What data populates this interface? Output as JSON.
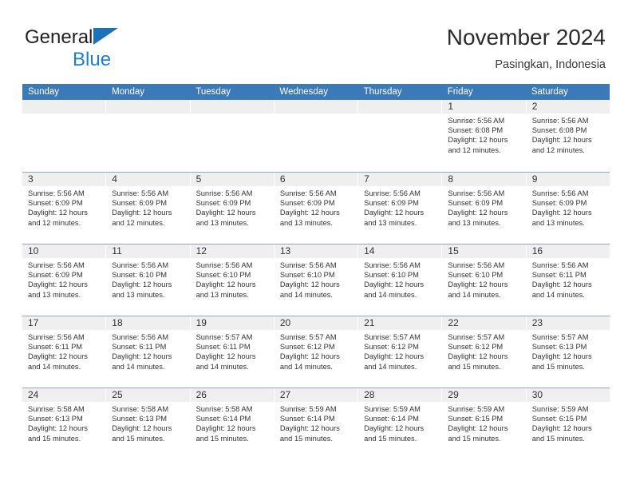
{
  "brand": {
    "name_part1": "General",
    "name_part2": "Blue",
    "flag_icon": "blue-triangle-flag-icon"
  },
  "header": {
    "title": "November 2024",
    "subtitle": "Pasingkan, Indonesia"
  },
  "colors": {
    "header_blue": "#3b79b8",
    "brand_blue": "#1a7fd4",
    "flag_blue": "#1d71b8",
    "day_band_gray": "#efefef",
    "week_separator": "#8ea9c4",
    "text": "#333333"
  },
  "weekdays": [
    "Sunday",
    "Monday",
    "Tuesday",
    "Wednesday",
    "Thursday",
    "Friday",
    "Saturday"
  ],
  "labels": {
    "sunrise_prefix": "Sunrise: ",
    "sunset_prefix": "Sunset: ",
    "daylight_prefix": "Daylight: "
  },
  "weeks": [
    [
      {
        "day": "",
        "empty": true,
        "line1": "",
        "line2": "",
        "line3": "",
        "line4": ""
      },
      {
        "day": "",
        "empty": true,
        "line1": "",
        "line2": "",
        "line3": "",
        "line4": ""
      },
      {
        "day": "",
        "empty": true,
        "line1": "",
        "line2": "",
        "line3": "",
        "line4": ""
      },
      {
        "day": "",
        "empty": true,
        "line1": "",
        "line2": "",
        "line3": "",
        "line4": ""
      },
      {
        "day": "",
        "empty": true,
        "line1": "",
        "line2": "",
        "line3": "",
        "line4": ""
      },
      {
        "day": "1",
        "empty": false,
        "line1": "Sunrise: 5:56 AM",
        "line2": "Sunset: 6:08 PM",
        "line3": "Daylight: 12 hours",
        "line4": "and 12 minutes."
      },
      {
        "day": "2",
        "empty": false,
        "line1": "Sunrise: 5:56 AM",
        "line2": "Sunset: 6:08 PM",
        "line3": "Daylight: 12 hours",
        "line4": "and 12 minutes."
      }
    ],
    [
      {
        "day": "3",
        "empty": false,
        "line1": "Sunrise: 5:56 AM",
        "line2": "Sunset: 6:09 PM",
        "line3": "Daylight: 12 hours",
        "line4": "and 12 minutes."
      },
      {
        "day": "4",
        "empty": false,
        "line1": "Sunrise: 5:56 AM",
        "line2": "Sunset: 6:09 PM",
        "line3": "Daylight: 12 hours",
        "line4": "and 12 minutes."
      },
      {
        "day": "5",
        "empty": false,
        "line1": "Sunrise: 5:56 AM",
        "line2": "Sunset: 6:09 PM",
        "line3": "Daylight: 12 hours",
        "line4": "and 13 minutes."
      },
      {
        "day": "6",
        "empty": false,
        "line1": "Sunrise: 5:56 AM",
        "line2": "Sunset: 6:09 PM",
        "line3": "Daylight: 12 hours",
        "line4": "and 13 minutes."
      },
      {
        "day": "7",
        "empty": false,
        "line1": "Sunrise: 5:56 AM",
        "line2": "Sunset: 6:09 PM",
        "line3": "Daylight: 12 hours",
        "line4": "and 13 minutes."
      },
      {
        "day": "8",
        "empty": false,
        "line1": "Sunrise: 5:56 AM",
        "line2": "Sunset: 6:09 PM",
        "line3": "Daylight: 12 hours",
        "line4": "and 13 minutes."
      },
      {
        "day": "9",
        "empty": false,
        "line1": "Sunrise: 5:56 AM",
        "line2": "Sunset: 6:09 PM",
        "line3": "Daylight: 12 hours",
        "line4": "and 13 minutes."
      }
    ],
    [
      {
        "day": "10",
        "empty": false,
        "line1": "Sunrise: 5:56 AM",
        "line2": "Sunset: 6:09 PM",
        "line3": "Daylight: 12 hours",
        "line4": "and 13 minutes."
      },
      {
        "day": "11",
        "empty": false,
        "line1": "Sunrise: 5:56 AM",
        "line2": "Sunset: 6:10 PM",
        "line3": "Daylight: 12 hours",
        "line4": "and 13 minutes."
      },
      {
        "day": "12",
        "empty": false,
        "line1": "Sunrise: 5:56 AM",
        "line2": "Sunset: 6:10 PM",
        "line3": "Daylight: 12 hours",
        "line4": "and 13 minutes."
      },
      {
        "day": "13",
        "empty": false,
        "line1": "Sunrise: 5:56 AM",
        "line2": "Sunset: 6:10 PM",
        "line3": "Daylight: 12 hours",
        "line4": "and 14 minutes."
      },
      {
        "day": "14",
        "empty": false,
        "line1": "Sunrise: 5:56 AM",
        "line2": "Sunset: 6:10 PM",
        "line3": "Daylight: 12 hours",
        "line4": "and 14 minutes."
      },
      {
        "day": "15",
        "empty": false,
        "line1": "Sunrise: 5:56 AM",
        "line2": "Sunset: 6:10 PM",
        "line3": "Daylight: 12 hours",
        "line4": "and 14 minutes."
      },
      {
        "day": "16",
        "empty": false,
        "line1": "Sunrise: 5:56 AM",
        "line2": "Sunset: 6:11 PM",
        "line3": "Daylight: 12 hours",
        "line4": "and 14 minutes."
      }
    ],
    [
      {
        "day": "17",
        "empty": false,
        "line1": "Sunrise: 5:56 AM",
        "line2": "Sunset: 6:11 PM",
        "line3": "Daylight: 12 hours",
        "line4": "and 14 minutes."
      },
      {
        "day": "18",
        "empty": false,
        "line1": "Sunrise: 5:56 AM",
        "line2": "Sunset: 6:11 PM",
        "line3": "Daylight: 12 hours",
        "line4": "and 14 minutes."
      },
      {
        "day": "19",
        "empty": false,
        "line1": "Sunrise: 5:57 AM",
        "line2": "Sunset: 6:11 PM",
        "line3": "Daylight: 12 hours",
        "line4": "and 14 minutes."
      },
      {
        "day": "20",
        "empty": false,
        "line1": "Sunrise: 5:57 AM",
        "line2": "Sunset: 6:12 PM",
        "line3": "Daylight: 12 hours",
        "line4": "and 14 minutes."
      },
      {
        "day": "21",
        "empty": false,
        "line1": "Sunrise: 5:57 AM",
        "line2": "Sunset: 6:12 PM",
        "line3": "Daylight: 12 hours",
        "line4": "and 14 minutes."
      },
      {
        "day": "22",
        "empty": false,
        "line1": "Sunrise: 5:57 AM",
        "line2": "Sunset: 6:12 PM",
        "line3": "Daylight: 12 hours",
        "line4": "and 15 minutes."
      },
      {
        "day": "23",
        "empty": false,
        "line1": "Sunrise: 5:57 AM",
        "line2": "Sunset: 6:13 PM",
        "line3": "Daylight: 12 hours",
        "line4": "and 15 minutes."
      }
    ],
    [
      {
        "day": "24",
        "empty": false,
        "line1": "Sunrise: 5:58 AM",
        "line2": "Sunset: 6:13 PM",
        "line3": "Daylight: 12 hours",
        "line4": "and 15 minutes."
      },
      {
        "day": "25",
        "empty": false,
        "line1": "Sunrise: 5:58 AM",
        "line2": "Sunset: 6:13 PM",
        "line3": "Daylight: 12 hours",
        "line4": "and 15 minutes."
      },
      {
        "day": "26",
        "empty": false,
        "line1": "Sunrise: 5:58 AM",
        "line2": "Sunset: 6:14 PM",
        "line3": "Daylight: 12 hours",
        "line4": "and 15 minutes."
      },
      {
        "day": "27",
        "empty": false,
        "line1": "Sunrise: 5:59 AM",
        "line2": "Sunset: 6:14 PM",
        "line3": "Daylight: 12 hours",
        "line4": "and 15 minutes."
      },
      {
        "day": "28",
        "empty": false,
        "line1": "Sunrise: 5:59 AM",
        "line2": "Sunset: 6:14 PM",
        "line3": "Daylight: 12 hours",
        "line4": "and 15 minutes."
      },
      {
        "day": "29",
        "empty": false,
        "line1": "Sunrise: 5:59 AM",
        "line2": "Sunset: 6:15 PM",
        "line3": "Daylight: 12 hours",
        "line4": "and 15 minutes."
      },
      {
        "day": "30",
        "empty": false,
        "line1": "Sunrise: 5:59 AM",
        "line2": "Sunset: 6:15 PM",
        "line3": "Daylight: 12 hours",
        "line4": "and 15 minutes."
      }
    ]
  ]
}
